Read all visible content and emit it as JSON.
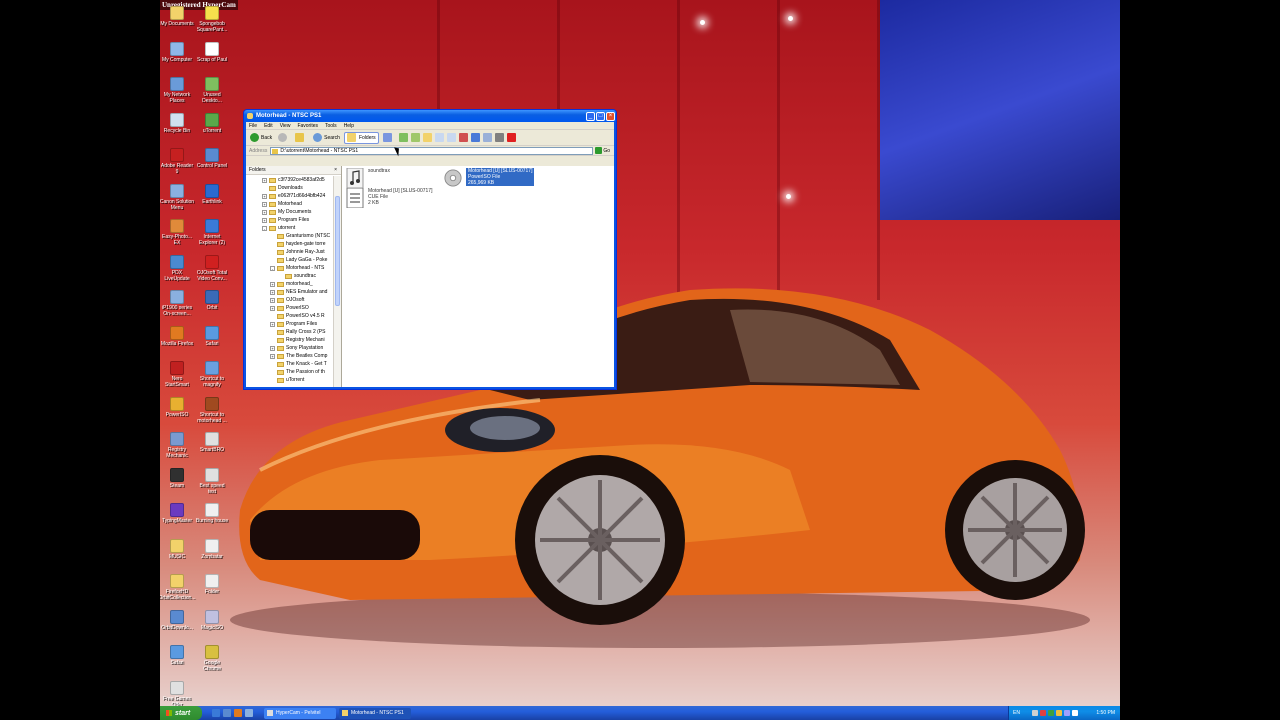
{
  "watermark": "Unregistered HyperCam",
  "desktop_icons": [
    {
      "label": "My Documents",
      "color": "#f2d26a"
    },
    {
      "label": "Spongebob\nSquarePant...",
      "color": "#f6e04c"
    },
    {
      "label": "My Computer",
      "color": "#8fb7e8"
    },
    {
      "label": "Scrap of Paul",
      "color": "#ffffff"
    },
    {
      "label": "My Network\nPlaces",
      "color": "#6a9bd8"
    },
    {
      "label": "Unused\nDeskto...",
      "color": "#7fbf5f"
    },
    {
      "label": "Recycle Bin",
      "color": "#d0e0f0"
    },
    {
      "label": "uTorrent",
      "color": "#5aa84a"
    },
    {
      "label": "Adobe Reader\n9",
      "color": "#c62020"
    },
    {
      "label": "Control Panel",
      "color": "#5a8ad0"
    },
    {
      "label": "Canon Solution\nMenu",
      "color": "#8ab0e0"
    },
    {
      "label": "Earthlink",
      "color": "#2a6ad0"
    },
    {
      "label": "Easy-Photo...\nEX",
      "color": "#e08a3a"
    },
    {
      "label": "Internet\nExplorer (2)",
      "color": "#3a7ad8"
    },
    {
      "label": "PDX\nLiveUpdate",
      "color": "#4a8ad0"
    },
    {
      "label": "OJOsoft Total\nVideo Conv...",
      "color": "#d02020"
    },
    {
      "label": "iP1900 series\nOn-screen...",
      "color": "#8ab0e0"
    },
    {
      "label": "Orbit",
      "color": "#3a6ab8"
    },
    {
      "label": "Mozilla Firefox",
      "color": "#e07a20"
    },
    {
      "label": "Safari",
      "color": "#5a9ae0"
    },
    {
      "label": "Nero\nStartSmart",
      "color": "#c02020"
    },
    {
      "label": "Shortcut to\nmagnify",
      "color": "#6aa0e0"
    },
    {
      "label": "PowerISO",
      "color": "#e8b030"
    },
    {
      "label": "Shortcut to\nmotorhead ...",
      "color": "#a04a20"
    },
    {
      "label": "Registry\nMechanic",
      "color": "#7a9ad0"
    },
    {
      "label": "SmartBRO",
      "color": "#e0e0e0"
    },
    {
      "label": "Steam",
      "color": "#303030"
    },
    {
      "label": "Best speed\ntest",
      "color": "#e0e0e0"
    },
    {
      "label": "TypingMaster",
      "color": "#6a3ac0"
    },
    {
      "label": "Burning house",
      "color": "#f0f0f0"
    },
    {
      "label": "MUSIC",
      "color": "#f2d26a"
    },
    {
      "label": "Zombatar",
      "color": "#f0f0f0"
    },
    {
      "label": "FirefoxHD\nOrbitCollection...",
      "color": "#f2d26a"
    },
    {
      "label": "Folder",
      "color": "#f0f0f0"
    },
    {
      "label": "OrbitDownlo...",
      "color": "#5a8ad0"
    },
    {
      "label": "MagicISO",
      "color": "#c0c0e0"
    },
    {
      "label": "Safari",
      "color": "#5a9ae0"
    },
    {
      "label": "Google\nChrome",
      "color": "#d8c040"
    },
    {
      "label": "Free Games\nOffer",
      "color": "#e0e0e0"
    }
  ],
  "window": {
    "title": "Motorhead - NTSC PS1",
    "menu": [
      "File",
      "Edit",
      "View",
      "Favorites",
      "Tools",
      "Help"
    ],
    "toolbar": {
      "back": "Back",
      "search": "Search",
      "folders": "Folders"
    },
    "address": {
      "label": "Address",
      "value": "D:\\utorrent\\Motorhead - NTSC PS1",
      "go": "Go"
    },
    "folders_title": "Folders",
    "folders_close": "×",
    "tree": [
      {
        "label": "c3f7392ce4583af2d5",
        "indent": 1,
        "exp": "+"
      },
      {
        "label": "Downloads",
        "indent": 1,
        "exp": ""
      },
      {
        "label": "e062f71d66d4bfb424",
        "indent": 1,
        "exp": "+"
      },
      {
        "label": "Motorhead",
        "indent": 1,
        "exp": "+"
      },
      {
        "label": "My Documents",
        "indent": 1,
        "exp": "+"
      },
      {
        "label": "Program Files",
        "indent": 1,
        "exp": "+"
      },
      {
        "label": "utorrent",
        "indent": 1,
        "exp": "-"
      },
      {
        "label": "Granturismo (NTSC",
        "indent": 2,
        "exp": ""
      },
      {
        "label": "hayden-gate torre",
        "indent": 2,
        "exp": ""
      },
      {
        "label": "Johnnie Ray-Just",
        "indent": 2,
        "exp": ""
      },
      {
        "label": "Lady GaGa - Poke",
        "indent": 2,
        "exp": ""
      },
      {
        "label": "Motorhead - NTS",
        "indent": 2,
        "exp": "-"
      },
      {
        "label": "soundtrac",
        "indent": 3,
        "exp": ""
      },
      {
        "label": "motorhead_",
        "indent": 2,
        "exp": "+"
      },
      {
        "label": "NES Emulator and",
        "indent": 2,
        "exp": "+"
      },
      {
        "label": "OJOsoft",
        "indent": 2,
        "exp": "+"
      },
      {
        "label": "PowerISO",
        "indent": 2,
        "exp": "+"
      },
      {
        "label": "PowerISO v4.5 R",
        "indent": 2,
        "exp": ""
      },
      {
        "label": "Program Files",
        "indent": 2,
        "exp": "+"
      },
      {
        "label": "Rally Cross 2 (PS",
        "indent": 2,
        "exp": ""
      },
      {
        "label": "Registry Mechani",
        "indent": 2,
        "exp": ""
      },
      {
        "label": "Sony Playstation",
        "indent": 2,
        "exp": "+"
      },
      {
        "label": "The Beatles Comp",
        "indent": 2,
        "exp": "+"
      },
      {
        "label": "The Knack - Get T",
        "indent": 2,
        "exp": ""
      },
      {
        "label": "The Passion of th",
        "indent": 2,
        "exp": ""
      },
      {
        "label": "uTorrent",
        "indent": 2,
        "exp": ""
      }
    ],
    "files": [
      {
        "name": "soundtrax",
        "line2": "",
        "line3": ""
      },
      {
        "name": "Motorhead [U] [SLUS-00717]",
        "line2": "PowerISO File",
        "line3": "265,969 KB"
      },
      {
        "name": "Motorhead [U] [SLUS-00717]",
        "line2": "CUE File",
        "line3": "2 KB"
      }
    ]
  },
  "taskbar": {
    "start": "start",
    "tasks": [
      "HyperCam - Pelvitel",
      "Motorhead - NTSC PS1"
    ],
    "lang": "EN",
    "clock": "1:50 PM"
  }
}
